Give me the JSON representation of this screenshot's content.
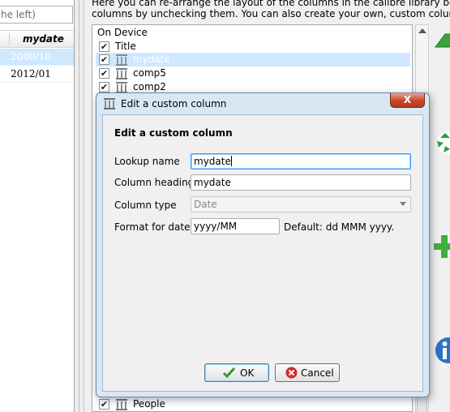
{
  "book_list": {
    "search_text": "he left)",
    "column_header": "mydate",
    "rows": [
      "2000/10",
      "2012/01"
    ]
  },
  "preferences": {
    "description_line1": "Here you can re-arrange the layout of the columns in the calibre library book list. You can hi",
    "description_line2": "columns by unchecking them. You can also create your own, custom columns.",
    "columns": [
      {
        "label": "On Device",
        "checked": false,
        "icon": "none"
      },
      {
        "label": "Title",
        "checked": true,
        "icon": "none"
      },
      {
        "label": "mydate",
        "checked": true,
        "icon": "column-icon",
        "selected": true
      },
      {
        "label": "comp5",
        "checked": true,
        "icon": "column-icon"
      },
      {
        "label": "comp2",
        "checked": true,
        "icon": "column-icon"
      },
      {
        "label": "People",
        "checked": true,
        "icon": "column-icon"
      }
    ],
    "side_icons": [
      "move-up-icon",
      "recycle-icon",
      "add-icon",
      "info-icon"
    ]
  },
  "dialog": {
    "window_title": "Edit a custom column",
    "heading": "Edit a custom column",
    "lookup_label": "Lookup name",
    "lookup_value": "mydate",
    "heading_label": "Column heading",
    "heading_value": "mydate",
    "type_label": "Column type",
    "type_value": "Date",
    "format_label": "Format for dates",
    "format_value": "yyyy/MM",
    "format_default": "Default: dd MMM yyyy.",
    "ok_label": "OK",
    "cancel_label": "Cancel",
    "close_symbol": "X",
    "colors": {
      "title_bar": "#d8e7f4",
      "close_button": "#c6452a",
      "selection": "#cde8ff",
      "focus_border": "#3399ff"
    }
  }
}
